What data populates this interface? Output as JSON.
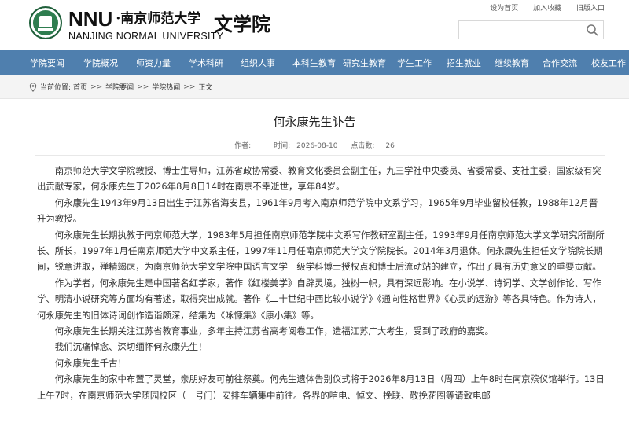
{
  "header": {
    "brand_nnu": "NNU",
    "brand_cn": "·南京师范大学",
    "brand_en": "NANJING NORMAL UNIVERSITY",
    "college": "文学院",
    "toplinks": [
      "设为首页",
      "加入收藏",
      "旧版入口"
    ],
    "search_placeholder": "",
    "search_icon": "search-icon",
    "logo_icon": "university-seal-icon"
  },
  "nav": {
    "items": [
      "学院要闻",
      "学院概况",
      "师资力量",
      "学术科研",
      "组织人事",
      "本科生教育",
      "研究生教育",
      "学生工作",
      "招生就业",
      "继续教育",
      "合作交流",
      "校友工作"
    ]
  },
  "breadcrumb": {
    "label": "当前位置:",
    "items": [
      "首页",
      "学院要闻",
      "学院热闻",
      "正文"
    ],
    "separator": ">>"
  },
  "article": {
    "title": "何永康先生讣告",
    "author_label": "作者:",
    "author": "",
    "time_label": "时间:",
    "time": "2026-08-10",
    "hits_label": "点击数:",
    "hits": "26",
    "paragraphs": [
      "南京师范大学文学院教授、博士生导师，江苏省政协常委、教育文化委员会副主任，九三学社中央委员、省委常委、支社主委，国家级有突出贡献专家，何永康先生于2026年8月8日14时在南京不幸逝世，享年84岁。",
      "何永康先生1943年9月13日出生于江苏省海安县，1961年9月考入南京师范学院中文系学习，1965年9月毕业留校任教，1988年12月晋升为教授。",
      "何永康先生长期执教于南京师范大学，1983年5月担任南京师范学院中文系写作教研室副主任，1993年9月任南京师范大学文学研究所副所长、所长，1997年1月任南京师范大学中文系主任，1997年11月任南京师范大学文学院院长。2014年3月退休。何永康先生担任文学院院长期间，锐意进取，殚精竭虑，为南京师范大学文学院中国语言文学一级学科博士授权点和博士后流动站的建立，作出了具有历史意义的重要贡献。",
      "作为学者，何永康先生是中国著名红学家，著作《红楼美学》自辟灵境，独树一帜，具有深远影响。在小说学、诗词学、文学创作论、写作学、明清小说研究等方面均有著述，取得突出成就。著作《二十世纪中西比较小说学》《通向性格世界》《心灵的远游》等各具特色。作为诗人，何永康先生的旧体诗词创作造诣颇深，结集为《咏慷集》《康小集》等。",
      "何永康先生长期关注江苏省教育事业，多年主持江苏省高考阅卷工作，造福江苏广大考生，受到了政府的嘉奖。",
      "我们沉痛悼念、深切缅怀何永康先生！",
      "何永康先生千古！",
      "何永康先生的家中布置了灵堂，亲朋好友可前往祭奠。何先生遗体告别仪式将于2026年8月13日（周四）上午8时在南京殡仪馆举行。13日上午7时，在南京师范大学随园校区（一号门）安排车辆集中前往。各界的唁电、悼文、挽联、敬挽花圈等请致电邮"
    ]
  }
}
